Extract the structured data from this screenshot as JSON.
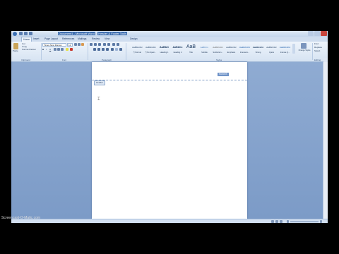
{
  "window": {
    "title_left": "Document1 - Microsoft Word",
    "title_right": "Header & Footer Tools"
  },
  "ribbon": {
    "tabs": [
      "Home",
      "Insert",
      "Page Layout",
      "References",
      "Mailings",
      "Review",
      "View",
      "Design"
    ],
    "clipboard": {
      "paste": "Paste",
      "cut": "Cut",
      "copy": "Copy",
      "format_painter": "Format Painter",
      "group_label": "Clipboard"
    },
    "font": {
      "family": "Times New Roman",
      "size": "12",
      "group_label": "Font"
    },
    "paragraph": {
      "group_label": "Paragraph"
    },
    "styles": {
      "items": [
        {
          "preview": "AaBbCcDc",
          "name": "¶ Normal"
        },
        {
          "preview": "AaBbCcDc",
          "name": "¶ No Spaci..."
        },
        {
          "preview": "AaBbC",
          "name": "Heading 1"
        },
        {
          "preview": "AaBbCc",
          "name": "Heading 2"
        },
        {
          "preview": "AaB",
          "name": "Title"
        },
        {
          "preview": "AaBbCc.",
          "name": "Subtitle"
        },
        {
          "preview": "AaBbCcDc",
          "name": "Subtle Em..."
        },
        {
          "preview": "AaBbCcDc",
          "name": "Emphasis"
        },
        {
          "preview": "AaBbCcDc",
          "name": "Intense E..."
        },
        {
          "preview": "AaBbCcDc",
          "name": "Strong"
        },
        {
          "preview": "AaBbCcDc",
          "name": "Quote"
        },
        {
          "preview": "AaBbCcDc",
          "name": "Intense Q..."
        }
      ],
      "change_styles": "Change Styles",
      "group_label": "Styles"
    },
    "editing": {
      "find": "Find",
      "replace": "Replace",
      "select": "Select",
      "group_label": "Editing"
    }
  },
  "document": {
    "header_tag": "Header",
    "selected_text": "Home B"
  },
  "watermark": "Screencast-O-Matic.com",
  "colors": {
    "desktop": "#8aa7cf",
    "ribbon": "#eef4fb",
    "page": "#ffffff",
    "selection": "#6f93c8"
  }
}
